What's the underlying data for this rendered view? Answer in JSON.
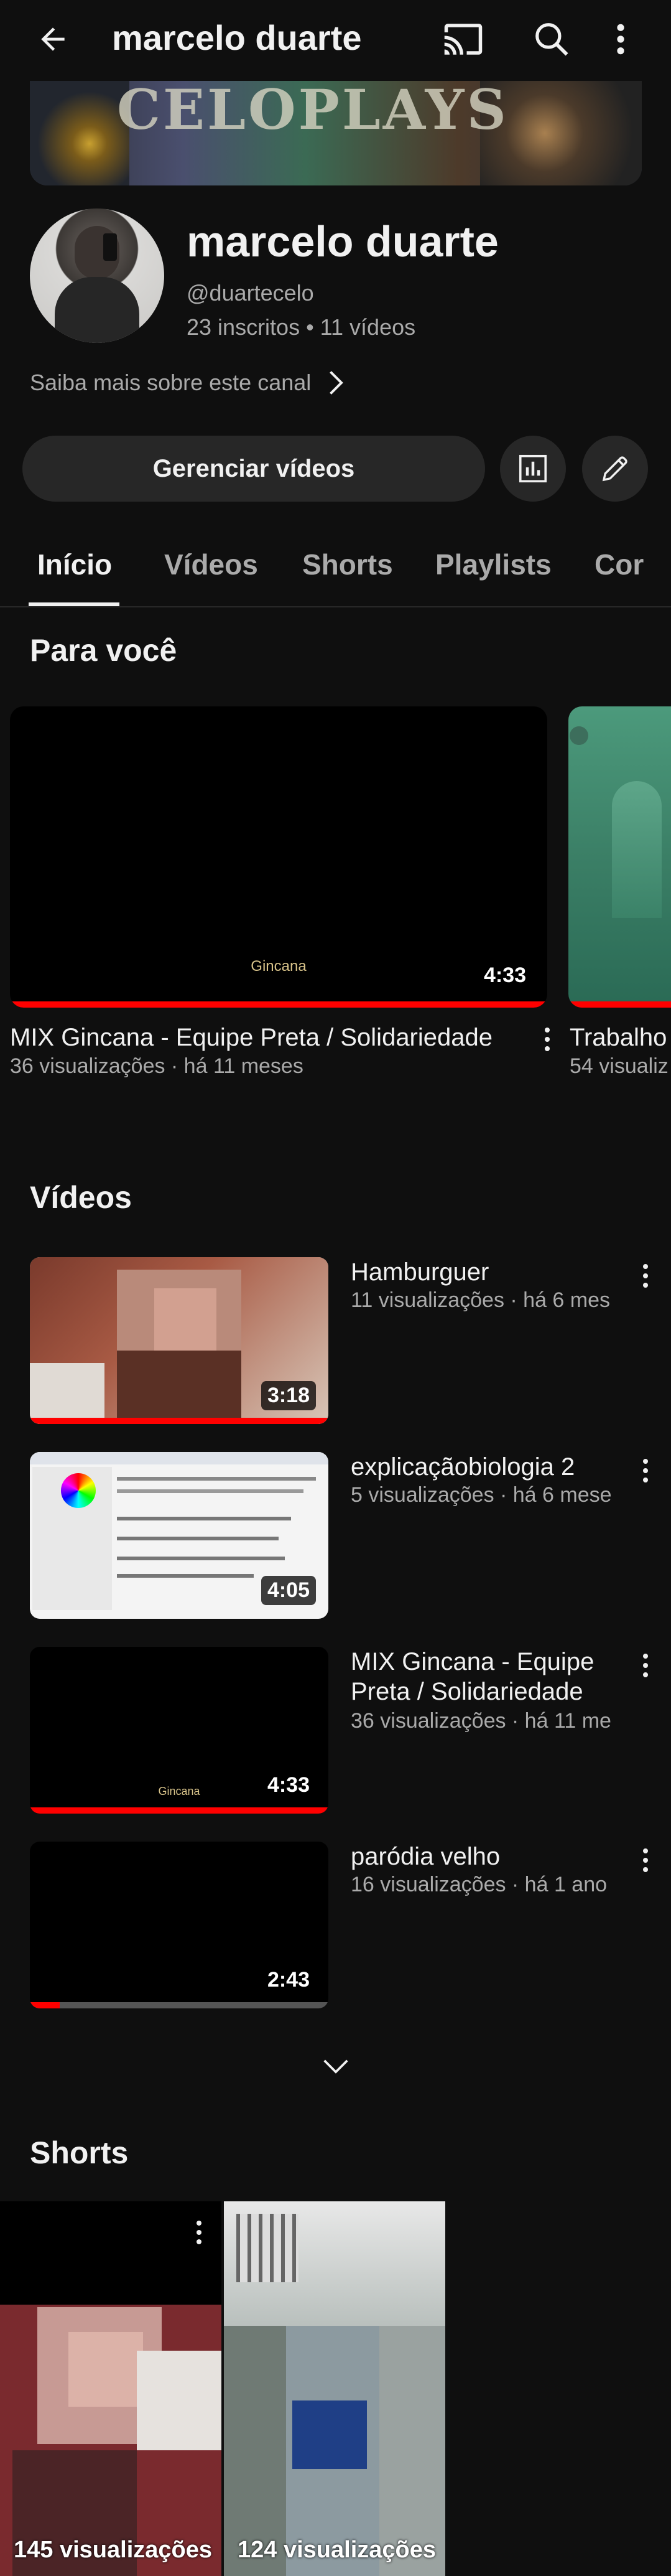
{
  "topbar": {
    "title": "marcelo duarte",
    "back_icon": "arrow-left-icon",
    "cast_icon": "cast-icon",
    "search_icon": "search-icon",
    "more_icon": "more-vert-icon"
  },
  "banner": {
    "text": "CELOPLAYS"
  },
  "channel": {
    "name": "marcelo duarte",
    "handle": "@duartecelo",
    "stats": "23 inscritos • 11 vídeos",
    "about": "Saiba mais sobre este canal"
  },
  "actions": {
    "manage_label": "Gerenciar vídeos",
    "analytics_icon": "analytics-icon",
    "edit_icon": "pencil-icon"
  },
  "tabs": [
    "Início",
    "Vídeos",
    "Shorts",
    "Playlists",
    "Cor"
  ],
  "for_you": {
    "title": "Para você",
    "cards": [
      {
        "title": "MIX Gincana - Equipe Preta / Solidariedade",
        "meta": "36 visualizações · há 11 meses",
        "duration": "4:33",
        "caption": "Gincana",
        "progress": 1.0
      },
      {
        "title": "Trabalho",
        "meta": "54 visualiz",
        "progress": 1.0
      }
    ]
  },
  "videos": {
    "title": "Vídeos",
    "items": [
      {
        "title": "Hamburguer",
        "meta": "11 visualizações · há 6 mes",
        "duration": "3:18",
        "progress": 1.0
      },
      {
        "title": "explicaçãobiologia 2",
        "meta": "5 visualizações · há 6 mese",
        "duration": "4:05",
        "progress": 0.0
      },
      {
        "title": "MIX Gincana - Equipe Preta / Solidariedade",
        "meta": "36 visualizações · há 11 me",
        "duration": "4:33",
        "caption": "Gincana",
        "progress": 1.0
      },
      {
        "title": "paródia velho",
        "meta": "16 visualizações · há 1 ano",
        "duration": "2:43",
        "progress": 0.1
      }
    ],
    "expand_icon": "chevron-down-icon"
  },
  "shorts": {
    "title": "Shorts",
    "items": [
      {
        "views": "145 visualizações"
      },
      {
        "views": "124 visualizações"
      }
    ]
  },
  "colors": {
    "background": "#0f0f0f",
    "surface": "#272727",
    "accent_red": "#ff0000",
    "text_primary": "#f1f1f1",
    "text_secondary": "#aaaaaa"
  }
}
